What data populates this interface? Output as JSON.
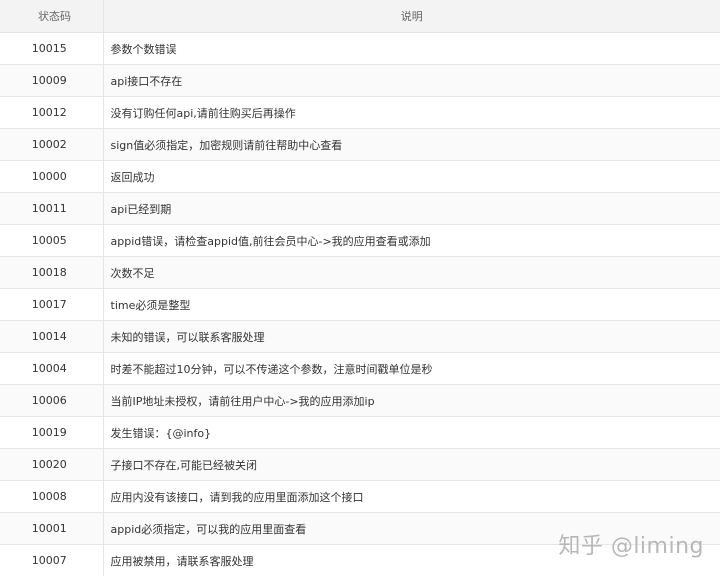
{
  "table": {
    "headers": [
      "状态码",
      "说明"
    ],
    "rows": [
      {
        "code": "10015",
        "desc": "参数个数错误"
      },
      {
        "code": "10009",
        "desc": "api接口不存在"
      },
      {
        "code": "10012",
        "desc": "没有订购任何api,请前往购买后再操作"
      },
      {
        "code": "10002",
        "desc": "sign值必须指定，加密规则请前往帮助中心查看"
      },
      {
        "code": "10000",
        "desc": "返回成功"
      },
      {
        "code": "10011",
        "desc": "api已经到期"
      },
      {
        "code": "10005",
        "desc": "appid错误，请检查appid值,前往会员中心->我的应用查看或添加"
      },
      {
        "code": "10018",
        "desc": "次数不足"
      },
      {
        "code": "10017",
        "desc": "time必须是整型"
      },
      {
        "code": "10014",
        "desc": "未知的错误，可以联系客服处理"
      },
      {
        "code": "10004",
        "desc": "时差不能超过10分钟，可以不传递这个参数，注意时间戳单位是秒"
      },
      {
        "code": "10006",
        "desc": "当前IP地址未授权，请前往用户中心->我的应用添加ip"
      },
      {
        "code": "10019",
        "desc": "发生错误：{@info}"
      },
      {
        "code": "10020",
        "desc": "子接口不存在,可能已经被关闭"
      },
      {
        "code": "10008",
        "desc": "应用内没有该接口，请到我的应用里面添加这个接口"
      },
      {
        "code": "10001",
        "desc": "appid必须指定，可以我的应用里面查看"
      },
      {
        "code": "10007",
        "desc": "应用被禁用，请联系客服处理"
      }
    ]
  },
  "watermark": "知乎 @liming"
}
